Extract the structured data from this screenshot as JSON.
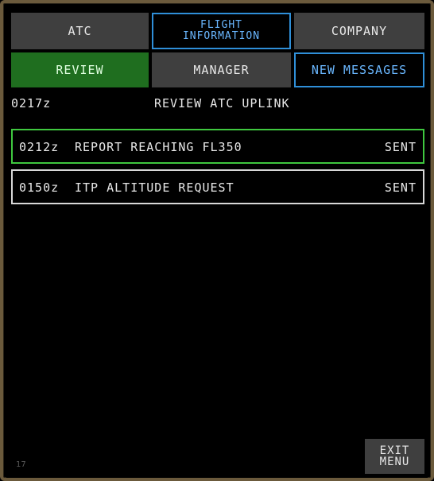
{
  "tabs": {
    "atc": "ATC",
    "flight_info_line1": "FLIGHT",
    "flight_info_line2": "INFORMATION",
    "company": "COMPANY"
  },
  "subtabs": {
    "review": "REVIEW",
    "manager": "MANAGER",
    "new_messages": "NEW MESSAGES"
  },
  "header": {
    "time": "0217z",
    "title": "REVIEW ATC UPLINK"
  },
  "messages": [
    {
      "time": "0212z",
      "text": "REPORT REACHING FL350",
      "status": "SENT"
    },
    {
      "time": "0150z",
      "text": "ITP ALTITUDE REQUEST",
      "status": "SENT"
    }
  ],
  "footer": {
    "page_number": "17",
    "exit_line1": "EXIT",
    "exit_line2": "MENU"
  },
  "colors": {
    "selected_tab_border": "#2f8fd8",
    "active_button": "#1f6e1f",
    "selected_row_border": "#3fc83f"
  }
}
